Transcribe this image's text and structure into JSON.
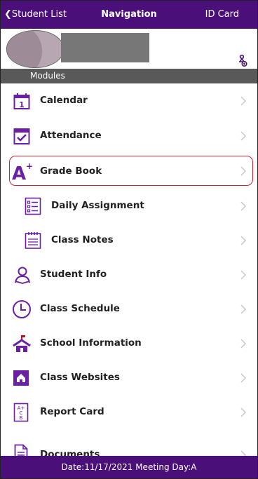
{
  "header": {
    "back_label": "Student List",
    "title": "Navigation",
    "right_label": "ID Card"
  },
  "profile": {
    "avatar": "student-photo",
    "name_redacted": true
  },
  "section": {
    "label": "Modules"
  },
  "modules": [
    {
      "label": "Calendar",
      "icon": "calendar-icon"
    },
    {
      "label": "Attendance",
      "icon": "attendance-check-icon"
    },
    {
      "label": "Grade Book",
      "icon": "a-plus-icon",
      "selected": true
    },
    {
      "label": "Daily Assignment",
      "icon": "checklist-icon"
    },
    {
      "label": "Class Notes",
      "icon": "notes-icon"
    },
    {
      "label": "Student Info",
      "icon": "student-icon"
    },
    {
      "label": "Class Schedule",
      "icon": "clock-icon"
    },
    {
      "label": "School Information",
      "icon": "school-icon"
    },
    {
      "label": "Class Websites",
      "icon": "website-icon"
    },
    {
      "label": "Report Card",
      "icon": "report-card-icon"
    },
    {
      "label": "Documents",
      "icon": "document-icon"
    }
  ],
  "footer": {
    "text": "Date:11/17/2021 Meeting Day:A"
  },
  "colors": {
    "brand": "#4a0f78",
    "section": "#595959",
    "highlight": "#d0252f"
  }
}
